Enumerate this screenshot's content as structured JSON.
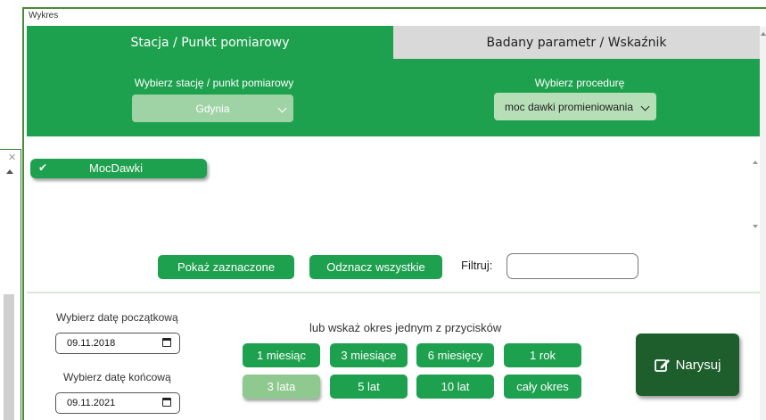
{
  "side_panel": {
    "close_icon": "✕"
  },
  "window": {
    "title": "Wykres"
  },
  "tabs": [
    {
      "label": "Stacja / Punkt pomiarowy",
      "active": true
    },
    {
      "label": "Badany parametr / Wskaźnik",
      "active": false
    }
  ],
  "station": {
    "label": "Wybierz stację / punkt pomiarowy",
    "selected": "Gdynia"
  },
  "procedure": {
    "label": "Wybierz procedurę",
    "selected": "moc dawki promieniowania"
  },
  "series_list": [
    {
      "label": "MocDawki",
      "checked": true
    }
  ],
  "actions": {
    "show_selected": "Pokaż zaznaczone",
    "uncheck_all": "Odznacz wszystkie",
    "filter_label": "Filtruj:",
    "filter_value": ""
  },
  "dates": {
    "start_label": "Wybierz datę początkową",
    "start_value": "09.11.2018",
    "end_label": "Wybierz datę końcową",
    "end_value": "09.11.2021"
  },
  "periods": {
    "label": "lub wskaż okres jednym z przycisków",
    "buttons": [
      "1 miesiąc",
      "3 miesiące",
      "6 miesięcy",
      "1 rok",
      "3 lata",
      "5 lat",
      "10 lat",
      "cały okres"
    ],
    "selected": "3 lata"
  },
  "draw_button": {
    "label": "Narysuj",
    "icon": "edit-icon"
  },
  "colors": {
    "primary_green": "#1ea14e",
    "dark_green": "#1e5e2c",
    "selected_green": "#8fc98f"
  }
}
